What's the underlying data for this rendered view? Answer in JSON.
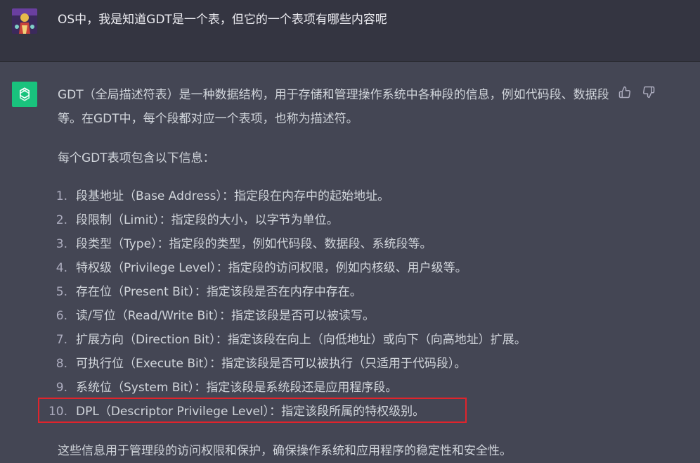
{
  "user_message": {
    "text": "OS中，我是知道GDT是一个表，但它的一个表项有哪些内容呢"
  },
  "assistant_message": {
    "intro": "GDT（全局描述符表）是一种数据结构，用于存储和管理操作系统中各种段的信息，例如代码段、数据段等。在GDT中，每个段都对应一个表项，也称为描述符。",
    "lead": "每个GDT表项包含以下信息：",
    "items": [
      {
        "num": "1.",
        "text": "段基地址（Base Address）：指定段在内存中的起始地址。"
      },
      {
        "num": "2.",
        "text": "段限制（Limit）：指定段的大小，以字节为单位。"
      },
      {
        "num": "3.",
        "text": "段类型（Type）：指定段的类型，例如代码段、数据段、系统段等。"
      },
      {
        "num": "4.",
        "text": "特权级（Privilege Level）：指定段的访问权限，例如内核级、用户级等。"
      },
      {
        "num": "5.",
        "text": "存在位（Present Bit）：指定该段是否在内存中存在。"
      },
      {
        "num": "6.",
        "text": "读/写位（Read/Write Bit）：指定该段是否可以被读写。"
      },
      {
        "num": "7.",
        "text": "扩展方向（Direction Bit）：指定该段在向上（向低地址）或向下（向高地址）扩展。"
      },
      {
        "num": "8.",
        "text": "可执行位（Execute Bit）：指定该段是否可以被执行（只适用于代码段）。"
      },
      {
        "num": "9.",
        "text": "系统位（System Bit）：指定该段是系统段还是应用程序段。"
      },
      {
        "num": "10.",
        "text": "DPL（Descriptor Privilege Level）：指定该段所属的特权级别。"
      }
    ],
    "conclusion": "这些信息用于管理段的访问权限和保护，确保操作系统和应用程序的稳定性和安全性。"
  },
  "icons": {
    "user_avatar": "user-avatar",
    "assistant_logo": "openai-logo-icon",
    "thumbs_up": "thumbs-up-icon",
    "thumbs_down": "thumbs-down-icon"
  },
  "colors": {
    "user_bg": "#343541",
    "assistant_bg": "#444654",
    "brand": "#19c37d",
    "highlight": "#e0242c"
  }
}
